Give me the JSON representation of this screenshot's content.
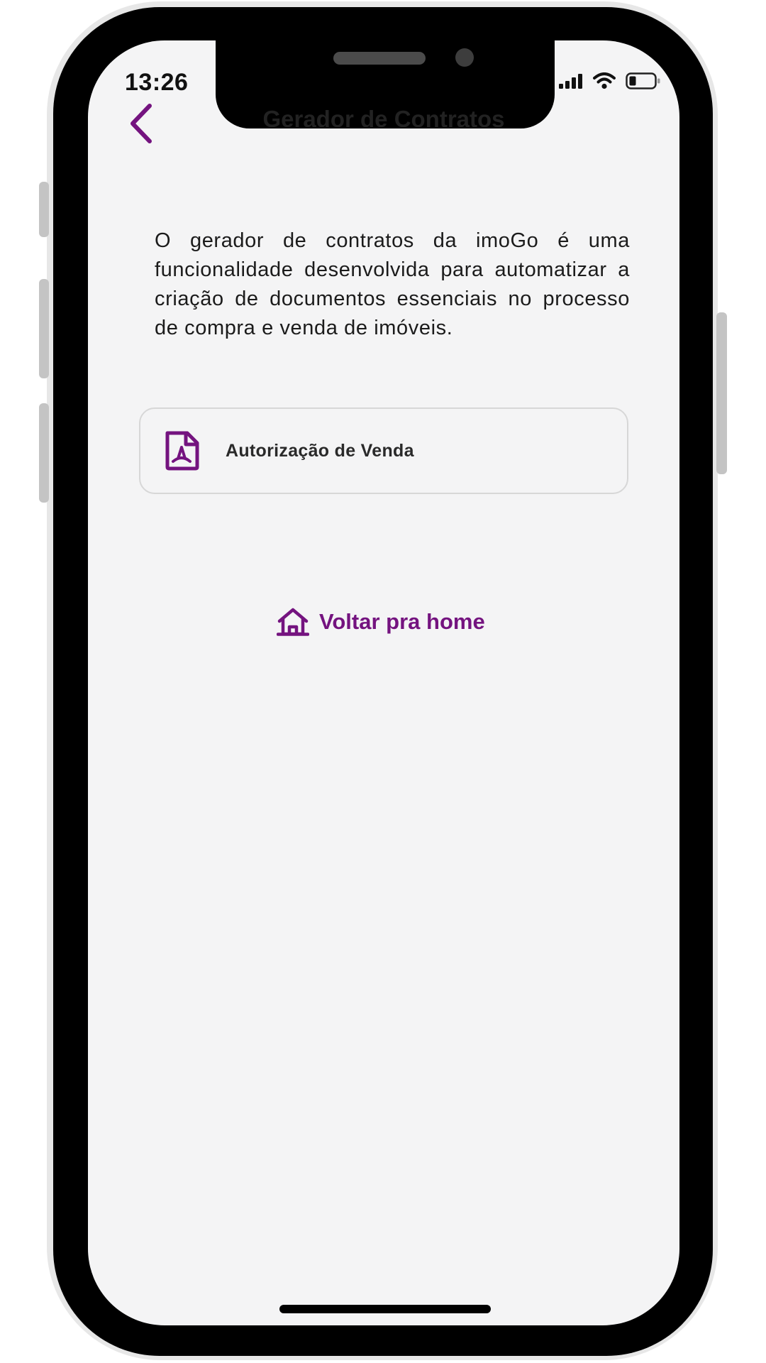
{
  "status_bar": {
    "time": "13:26"
  },
  "header": {
    "title": "Gerador de Contratos",
    "back_icon": "chevron-left-icon"
  },
  "main": {
    "description": "O gerador de contratos da imoGo é uma funcionalidade desenvolvida para automatizar a criação de documentos essenciais no processo de compra e venda de imóveis.",
    "contracts": [
      {
        "label": "Autorização de Venda",
        "icon": "pdf-file-icon"
      }
    ],
    "home_link": {
      "label": "Voltar pra home",
      "icon": "home-icon"
    }
  },
  "colors": {
    "accent": "#74137f",
    "background": "#f4f4f5",
    "card_border": "#d7d7d7",
    "text": "#222222"
  }
}
